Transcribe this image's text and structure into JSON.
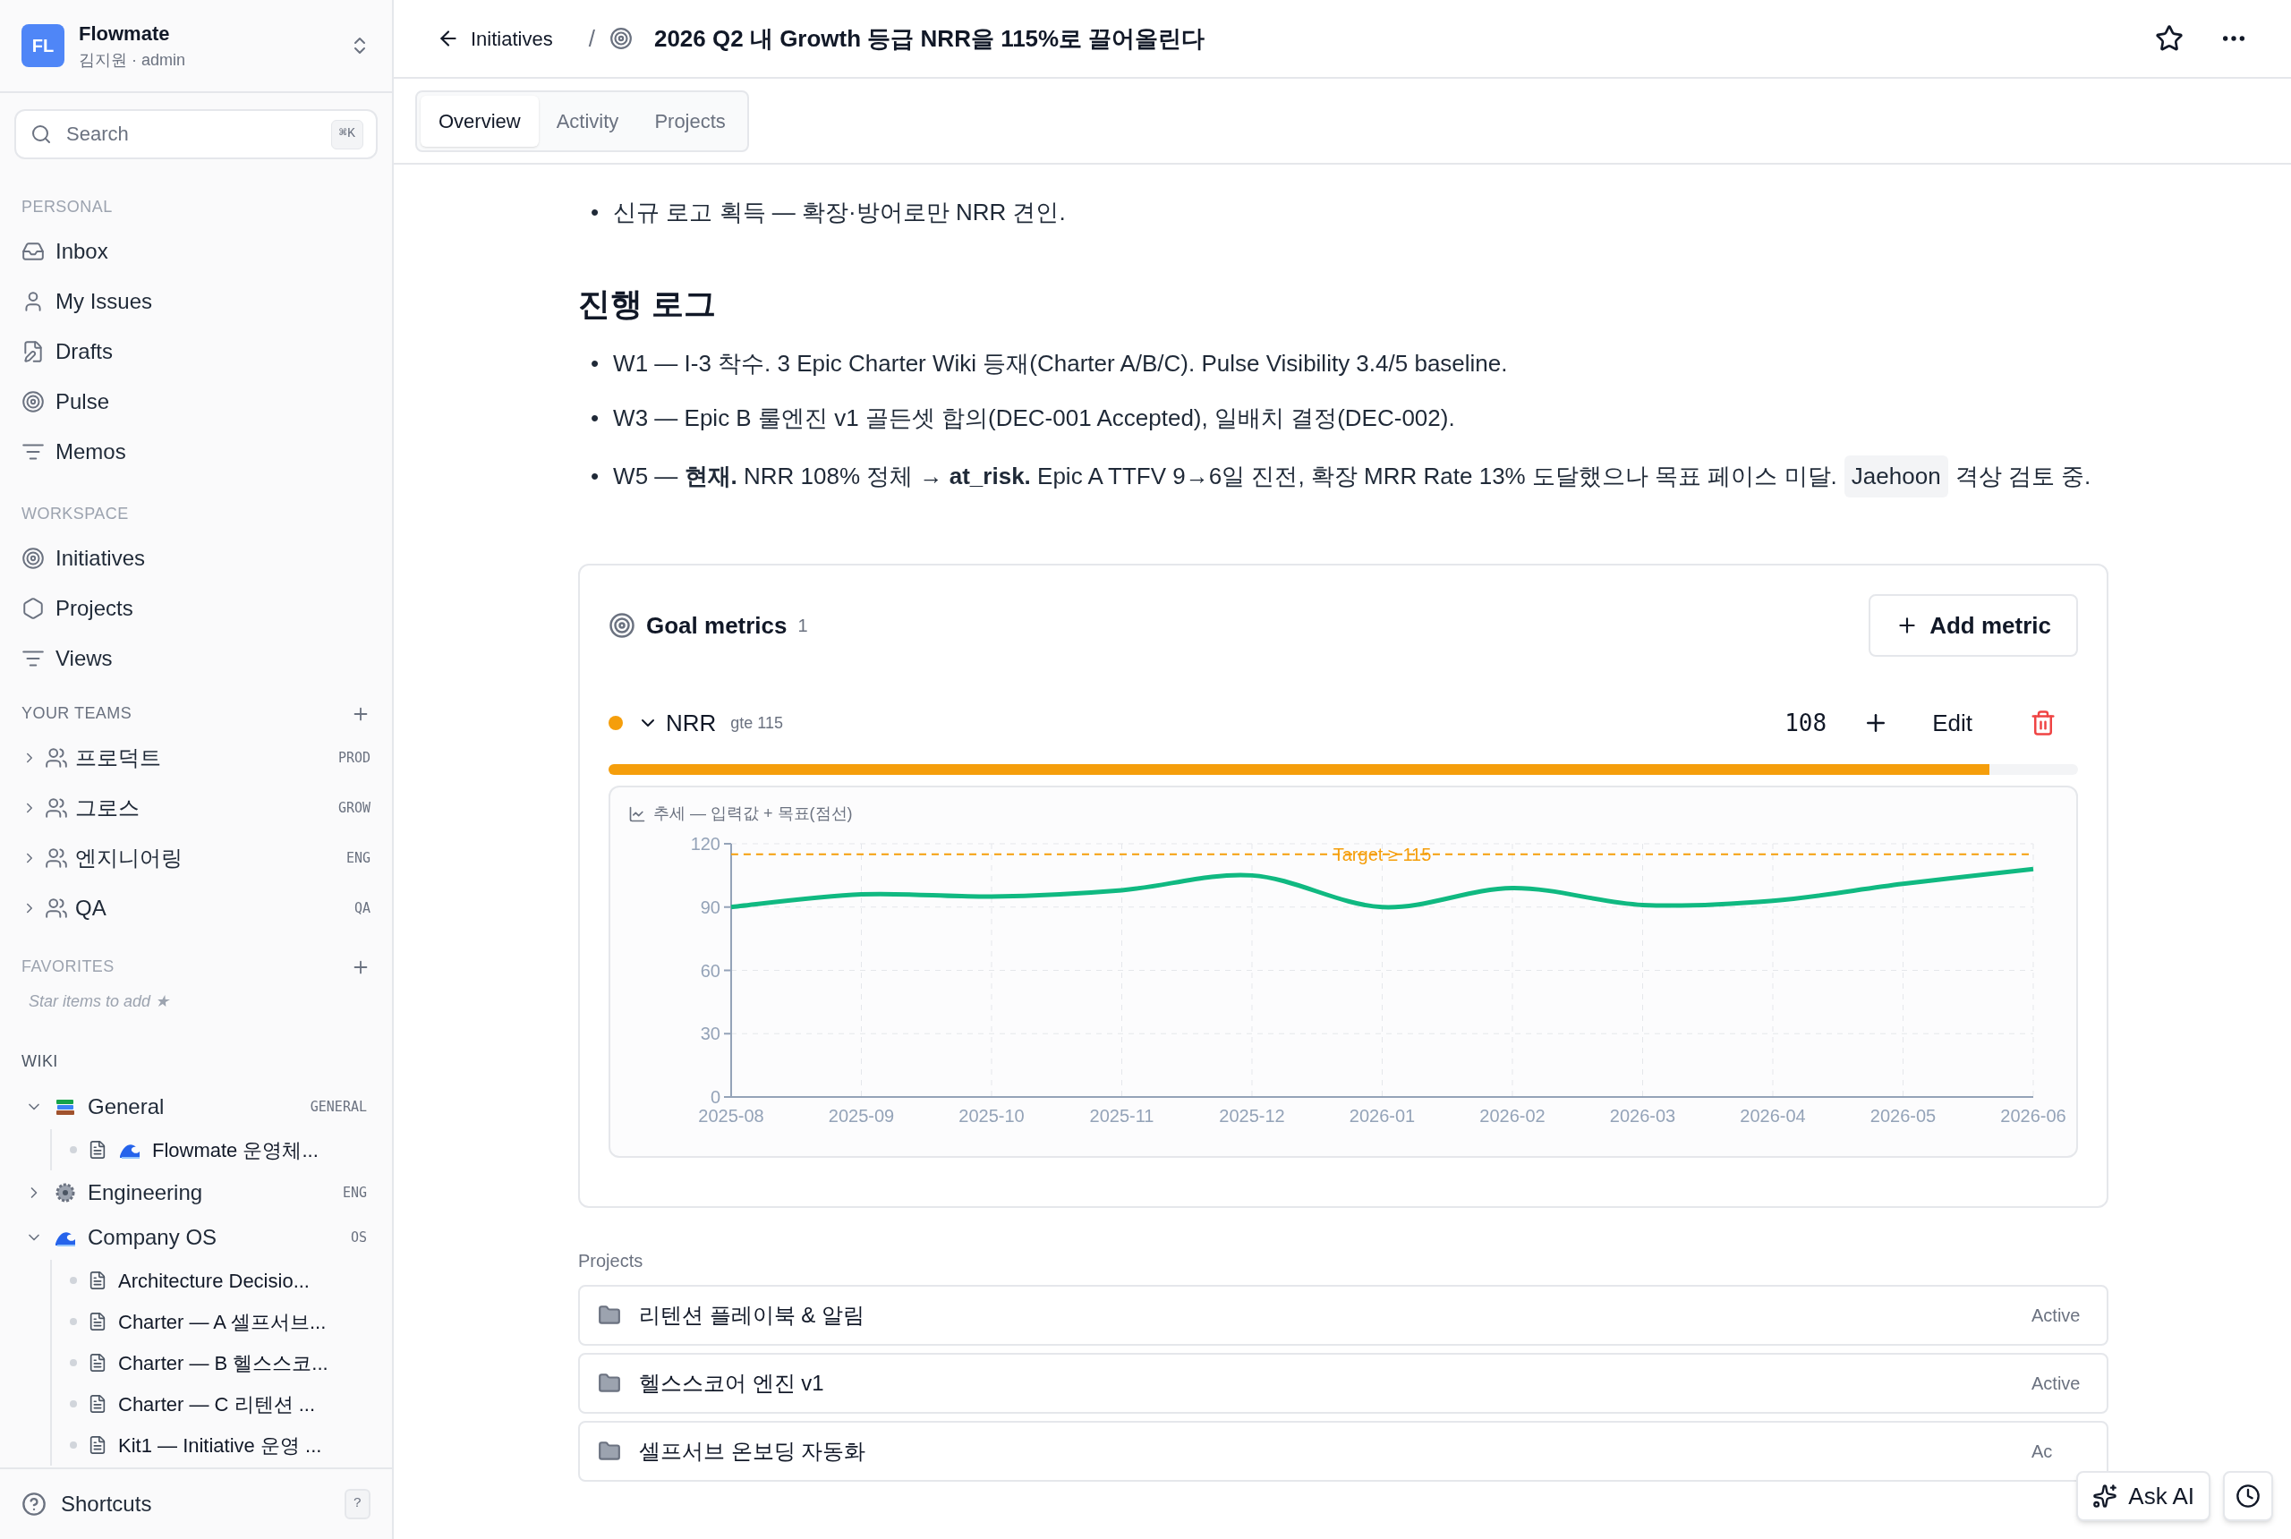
{
  "workspace": {
    "initials": "FL",
    "name": "Flowmate",
    "user": "김지원 · admin"
  },
  "search": {
    "placeholder": "Search",
    "shortcut": "⌘K"
  },
  "personal": {
    "title": "PERSONAL",
    "items": [
      "Inbox",
      "My Issues",
      "Drafts",
      "Pulse",
      "Memos"
    ]
  },
  "workspace_nav": {
    "title": "WORKSPACE",
    "items": [
      "Initiatives",
      "Projects",
      "Views"
    ]
  },
  "teams": {
    "title": "YOUR TEAMS",
    "items": [
      {
        "name": "프로덕트",
        "key": "PROD",
        "expanded": false
      },
      {
        "name": "그로스",
        "key": "GROW",
        "expanded": false
      },
      {
        "name": "엔지니어링",
        "key": "ENG",
        "expanded": false
      },
      {
        "name": "QA",
        "key": "QA",
        "expanded": false
      }
    ]
  },
  "favorites": {
    "title": "FAVORITES",
    "empty": "Star items to add ★"
  },
  "wiki": {
    "title": "WIKI",
    "spaces": [
      {
        "name": "General",
        "key": "GENERAL",
        "kind": "books",
        "expanded": true,
        "children": [
          {
            "title": "Flowmate 운영체...",
            "kind": "wave"
          }
        ]
      },
      {
        "name": "Engineering",
        "key": "ENG",
        "kind": "gear",
        "expanded": false
      },
      {
        "name": "Company OS",
        "key": "OS",
        "kind": "wave",
        "expanded": true,
        "children": [
          {
            "title": "Architecture Decisio...",
            "kind": "plain"
          },
          {
            "title": "Charter — A 셀프서브...",
            "kind": "plain"
          },
          {
            "title": "Charter — B 헬스스코...",
            "kind": "plain"
          },
          {
            "title": "Charter — C 리텐션 ...",
            "kind": "plain"
          },
          {
            "title": "Kit1 — Initiative 운영 ...",
            "kind": "plain"
          }
        ]
      }
    ]
  },
  "shortcuts": {
    "label": "Shortcuts",
    "key": "?"
  },
  "breadcrumb": {
    "parent": "Initiatives",
    "separator": "/",
    "title": "2026 Q2 내 Growth 등급 NRR을 115%로 끌어올린다"
  },
  "tabs": [
    {
      "label": "Overview",
      "selected": true
    },
    {
      "label": "Activity",
      "selected": false
    },
    {
      "label": "Projects",
      "selected": false
    }
  ],
  "top_bullets": [
    {
      "marker": "•",
      "text": "신규 로고 획득 — 확장·방어로만 NRR 견인."
    }
  ],
  "log": {
    "heading": "진행 로그",
    "items": [
      {
        "marker": "•",
        "text": "W1 — I-3 착수. 3 Epic Charter Wiki 등재(Charter A/B/C). Pulse Visibility 3.4/5 baseline."
      },
      {
        "marker": "•",
        "text": "W3 — Epic B 룰엔진 v1 골든셋 합의(DEC-001 Accepted), 일배치 결정(DEC-002)."
      },
      {
        "marker": "•",
        "text": "W5 — **현재.** NRR 108% 정체 → **at_risk.** Epic A TTFV 9→6일 진전, 확장 MRR Rate 13% 도달했으나 목표 페이스 미달.",
        "mention": "Jaehoon",
        "after": "격상 검토 중."
      }
    ]
  },
  "goal_metrics": {
    "title": "Goal metrics",
    "count": "1",
    "add_button": "Add metric",
    "metrics": [
      {
        "name": "NRR",
        "condition": "gte 115",
        "color": "#f59e0b",
        "expanded": true,
        "value": "108",
        "edit": "Edit",
        "level": 0.94,
        "chart_title": "추세 — 입력값 + 목표(점선)",
        "chart_data": {
          "type": "line",
          "categories": [
            "2025-08",
            "2025-09",
            "2025-10",
            "2025-11",
            "2025-12",
            "2026-01",
            "2026-02",
            "2026-03",
            "2026-04",
            "2026-05",
            "2026-06"
          ],
          "series": [
            {
              "color": "#10b981",
              "values": [
                90,
                96,
                95,
                98,
                105,
                90,
                99,
                91,
                93,
                101,
                108
              ]
            },
            {
              "name": "Target ≥ 115",
              "color": "#f59e0b",
              "line_style": "dashed",
              "values": [
                115,
                115,
                115,
                115,
                115,
                115,
                115,
                115,
                115,
                115,
                115
              ]
            }
          ],
          "ylim": [
            0,
            120
          ],
          "yticks": [
            0,
            30,
            60,
            90,
            120
          ],
          "grid": true
        }
      }
    ]
  },
  "projects": {
    "title": "Projects",
    "items": [
      {
        "name": "리텐션 플레이북 & 알림",
        "status": "Active"
      },
      {
        "name": "헬스스코어 엔진 v1",
        "status": "Active"
      },
      {
        "name": "셀프서브 온보딩 자동화",
        "status": "Ac"
      }
    ]
  },
  "ask_ai": "Ask AI"
}
